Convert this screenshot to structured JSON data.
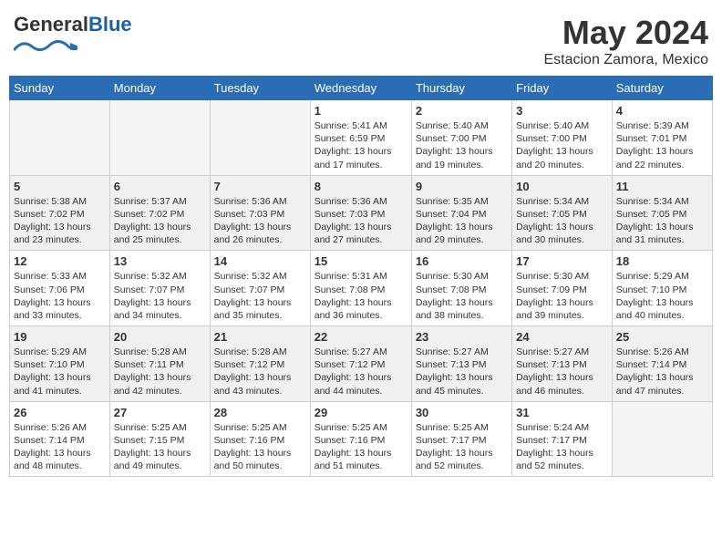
{
  "logo": {
    "general": "General",
    "blue": "Blue"
  },
  "header": {
    "month_year": "May 2024",
    "location": "Estacion Zamora, Mexico"
  },
  "days_of_week": [
    "Sunday",
    "Monday",
    "Tuesday",
    "Wednesday",
    "Thursday",
    "Friday",
    "Saturday"
  ],
  "weeks": [
    [
      {
        "day": "",
        "info": "",
        "empty": true
      },
      {
        "day": "",
        "info": "",
        "empty": true
      },
      {
        "day": "",
        "info": "",
        "empty": true
      },
      {
        "day": "1",
        "info": "Sunrise: 5:41 AM\nSunset: 6:59 PM\nDaylight: 13 hours\nand 17 minutes."
      },
      {
        "day": "2",
        "info": "Sunrise: 5:40 AM\nSunset: 7:00 PM\nDaylight: 13 hours\nand 19 minutes."
      },
      {
        "day": "3",
        "info": "Sunrise: 5:40 AM\nSunset: 7:00 PM\nDaylight: 13 hours\nand 20 minutes."
      },
      {
        "day": "4",
        "info": "Sunrise: 5:39 AM\nSunset: 7:01 PM\nDaylight: 13 hours\nand 22 minutes."
      }
    ],
    [
      {
        "day": "5",
        "info": "Sunrise: 5:38 AM\nSunset: 7:02 PM\nDaylight: 13 hours\nand 23 minutes."
      },
      {
        "day": "6",
        "info": "Sunrise: 5:37 AM\nSunset: 7:02 PM\nDaylight: 13 hours\nand 25 minutes."
      },
      {
        "day": "7",
        "info": "Sunrise: 5:36 AM\nSunset: 7:03 PM\nDaylight: 13 hours\nand 26 minutes."
      },
      {
        "day": "8",
        "info": "Sunrise: 5:36 AM\nSunset: 7:03 PM\nDaylight: 13 hours\nand 27 minutes."
      },
      {
        "day": "9",
        "info": "Sunrise: 5:35 AM\nSunset: 7:04 PM\nDaylight: 13 hours\nand 29 minutes."
      },
      {
        "day": "10",
        "info": "Sunrise: 5:34 AM\nSunset: 7:05 PM\nDaylight: 13 hours\nand 30 minutes."
      },
      {
        "day": "11",
        "info": "Sunrise: 5:34 AM\nSunset: 7:05 PM\nDaylight: 13 hours\nand 31 minutes."
      }
    ],
    [
      {
        "day": "12",
        "info": "Sunrise: 5:33 AM\nSunset: 7:06 PM\nDaylight: 13 hours\nand 33 minutes."
      },
      {
        "day": "13",
        "info": "Sunrise: 5:32 AM\nSunset: 7:07 PM\nDaylight: 13 hours\nand 34 minutes."
      },
      {
        "day": "14",
        "info": "Sunrise: 5:32 AM\nSunset: 7:07 PM\nDaylight: 13 hours\nand 35 minutes."
      },
      {
        "day": "15",
        "info": "Sunrise: 5:31 AM\nSunset: 7:08 PM\nDaylight: 13 hours\nand 36 minutes."
      },
      {
        "day": "16",
        "info": "Sunrise: 5:30 AM\nSunset: 7:08 PM\nDaylight: 13 hours\nand 38 minutes."
      },
      {
        "day": "17",
        "info": "Sunrise: 5:30 AM\nSunset: 7:09 PM\nDaylight: 13 hours\nand 39 minutes."
      },
      {
        "day": "18",
        "info": "Sunrise: 5:29 AM\nSunset: 7:10 PM\nDaylight: 13 hours\nand 40 minutes."
      }
    ],
    [
      {
        "day": "19",
        "info": "Sunrise: 5:29 AM\nSunset: 7:10 PM\nDaylight: 13 hours\nand 41 minutes."
      },
      {
        "day": "20",
        "info": "Sunrise: 5:28 AM\nSunset: 7:11 PM\nDaylight: 13 hours\nand 42 minutes."
      },
      {
        "day": "21",
        "info": "Sunrise: 5:28 AM\nSunset: 7:12 PM\nDaylight: 13 hours\nand 43 minutes."
      },
      {
        "day": "22",
        "info": "Sunrise: 5:27 AM\nSunset: 7:12 PM\nDaylight: 13 hours\nand 44 minutes."
      },
      {
        "day": "23",
        "info": "Sunrise: 5:27 AM\nSunset: 7:13 PM\nDaylight: 13 hours\nand 45 minutes."
      },
      {
        "day": "24",
        "info": "Sunrise: 5:27 AM\nSunset: 7:13 PM\nDaylight: 13 hours\nand 46 minutes."
      },
      {
        "day": "25",
        "info": "Sunrise: 5:26 AM\nSunset: 7:14 PM\nDaylight: 13 hours\nand 47 minutes."
      }
    ],
    [
      {
        "day": "26",
        "info": "Sunrise: 5:26 AM\nSunset: 7:14 PM\nDaylight: 13 hours\nand 48 minutes."
      },
      {
        "day": "27",
        "info": "Sunrise: 5:25 AM\nSunset: 7:15 PM\nDaylight: 13 hours\nand 49 minutes."
      },
      {
        "day": "28",
        "info": "Sunrise: 5:25 AM\nSunset: 7:16 PM\nDaylight: 13 hours\nand 50 minutes."
      },
      {
        "day": "29",
        "info": "Sunrise: 5:25 AM\nSunset: 7:16 PM\nDaylight: 13 hours\nand 51 minutes."
      },
      {
        "day": "30",
        "info": "Sunrise: 5:25 AM\nSunset: 7:17 PM\nDaylight: 13 hours\nand 52 minutes."
      },
      {
        "day": "31",
        "info": "Sunrise: 5:24 AM\nSunset: 7:17 PM\nDaylight: 13 hours\nand 52 minutes."
      },
      {
        "day": "",
        "info": "",
        "empty": true
      }
    ]
  ]
}
